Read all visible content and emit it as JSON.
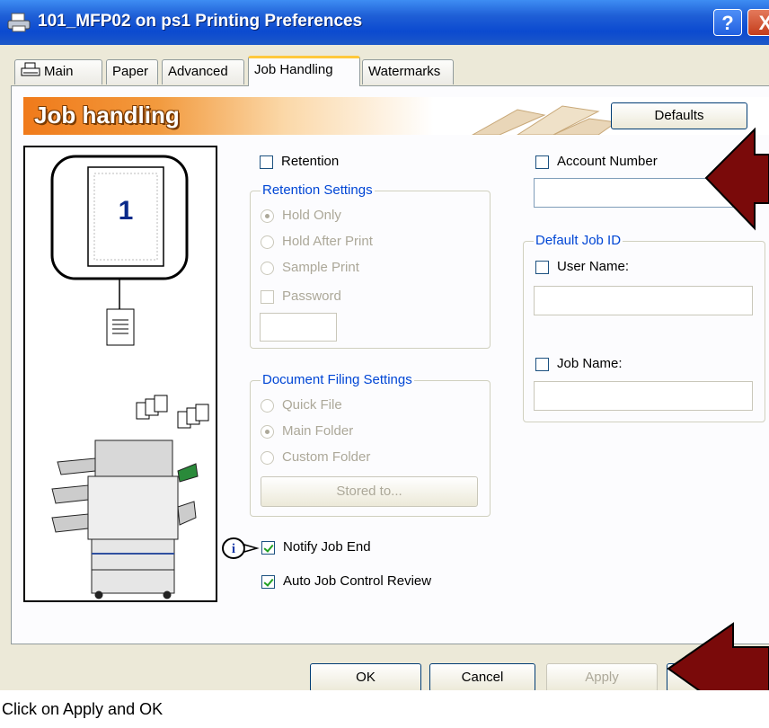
{
  "window": {
    "title": "101_MFP02 on ps1 Printing Preferences",
    "help_label": "?",
    "close_label": "X"
  },
  "tabs": [
    {
      "label": "Main"
    },
    {
      "label": "Paper"
    },
    {
      "label": "Advanced"
    },
    {
      "label": "Job Handling",
      "active": true
    },
    {
      "label": "Watermarks"
    }
  ],
  "banner": {
    "title": "Job handling",
    "defaults_label": "Defaults"
  },
  "preview": {
    "page_number": "1"
  },
  "retention": {
    "label": "Retention",
    "checked": false,
    "group_title": "Retention Settings",
    "options": [
      "Hold Only",
      "Hold After Print",
      "Sample Print"
    ],
    "selected": "Hold Only",
    "password_label": "Password"
  },
  "document_filing": {
    "group_title": "Document Filing Settings",
    "options": [
      "Quick File",
      "Main Folder",
      "Custom Folder"
    ],
    "selected": "Main Folder",
    "stored_to_label": "Stored to..."
  },
  "account_number": {
    "label": "Account Number",
    "checked": false
  },
  "default_job_id": {
    "group_title": "Default Job ID",
    "user_name_label": "User Name:",
    "job_name_label": "Job Name:"
  },
  "notify_job_end": {
    "label": "Notify Job End",
    "checked": true
  },
  "auto_job_control_review": {
    "label": "Auto Job Control Review",
    "checked": true
  },
  "footer": {
    "ok_label": "OK",
    "cancel_label": "Cancel",
    "apply_label": "Apply"
  },
  "caption": "Click on Apply and OK",
  "colors": {
    "title_bar": "#0b4ad0",
    "banner_orange": "#f07a1a",
    "annotation_arrow": "#7a0a0a",
    "group_title": "#0046d5"
  }
}
